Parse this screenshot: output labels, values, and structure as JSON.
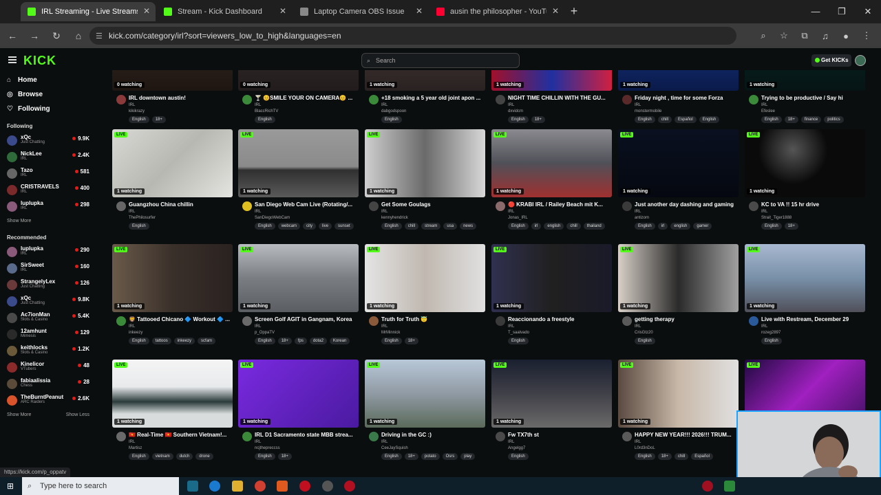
{
  "browser": {
    "tabs": [
      {
        "title": "IRL Streaming - Live Streams on Kick",
        "fav": "#53fc18",
        "active": true
      },
      {
        "title": "Stream - Kick Dashboard",
        "fav": "#53fc18",
        "active": false
      },
      {
        "title": "Laptop Camera OBS Issue",
        "fav": "#888888",
        "active": false
      },
      {
        "title": "ausin the philosopher - YouTube",
        "fav": "#ff0033",
        "active": false
      }
    ],
    "url": "kick.com/category/irl?sort=viewers_low_to_high&languages=en"
  },
  "header": {
    "logo": "KICK",
    "search_placeholder": "Search",
    "get_kicks": "Get KICKs"
  },
  "sidebar": {
    "nav": [
      {
        "label": "Home",
        "icon": "home-icon",
        "glyph": "⌂"
      },
      {
        "label": "Browse",
        "icon": "compass-icon",
        "glyph": "◎"
      },
      {
        "label": "Following",
        "icon": "heart-icon",
        "glyph": "♡"
      }
    ],
    "following_title": "Following",
    "following": [
      {
        "name": "xQc",
        "cat": "Just Chatting",
        "viewers": "9.9K",
        "color": "#3a4a8a"
      },
      {
        "name": "NickLee",
        "cat": "IRL",
        "viewers": "2.4K",
        "color": "#2f6b3a"
      },
      {
        "name": "Tazo",
        "cat": "IRL",
        "viewers": "581",
        "color": "#666666"
      },
      {
        "name": "CRISTRAVELS",
        "cat": "IRL",
        "viewers": "400",
        "color": "#7a2a2a"
      },
      {
        "name": "luplupka",
        "cat": "IRL",
        "viewers": "298",
        "color": "#8a5a7a"
      }
    ],
    "show_more": "Show More",
    "recommended_title": "Recommended",
    "recommended": [
      {
        "name": "luplupka",
        "cat": "IRL",
        "viewers": "290",
        "color": "#8a5a7a"
      },
      {
        "name": "SirSweet",
        "cat": "IRL",
        "viewers": "160",
        "color": "#5a6a8a"
      },
      {
        "name": "StrangelyLex",
        "cat": "Just Chatting",
        "viewers": "126",
        "color": "#6a3a3a"
      },
      {
        "name": "xQc",
        "cat": "Just Chatting",
        "viewers": "9.8K",
        "color": "#3a4a8a"
      },
      {
        "name": "Ac7ionMan",
        "cat": "Slots & Casino",
        "viewers": "5.4K",
        "color": "#4a4a4a"
      },
      {
        "name": "12amhunt",
        "cat": "Mimesis",
        "viewers": "129",
        "color": "#2a2a2a"
      },
      {
        "name": "keithlocks",
        "cat": "Slots & Casino",
        "viewers": "1.2K",
        "color": "#6a5a3a"
      },
      {
        "name": "Kinelicor",
        "cat": "VTubers",
        "viewers": "48",
        "color": "#8a2a2a"
      },
      {
        "name": "fabiaalissia",
        "cat": "Chess",
        "viewers": "28",
        "color": "#5a4a3a"
      },
      {
        "name": "TheBurntPeanut",
        "cat": "ARC Raiders",
        "viewers": "2.6K",
        "color": "#d9542a"
      }
    ],
    "show_more_2": "Show More",
    "show_less": "Show Less"
  },
  "streams": [
    {
      "title": "IRL downtown austin!",
      "cat": "IRL",
      "user": "kikikrazy",
      "watching": "0 watching",
      "tags": [
        "English",
        "18+"
      ],
      "bg": "linear-gradient(#3a2a22,#1e1612)",
      "ava": "#8a3a3a"
    },
    {
      "title": "🍸 😊SMILE YOUR ON CAMERA😊 ...",
      "cat": "IRL",
      "user": "BlaccRichTV",
      "watching": "0 watching",
      "tags": [
        "English"
      ],
      "bg": "linear-gradient(#3a3030,#221c1c)",
      "ava": "#3a8a3a"
    },
    {
      "title": "+18 smoking a 5 year old joint apon ...",
      "cat": "IRL",
      "user": "dabgodspoon",
      "watching": "1 watching",
      "tags": [
        "English"
      ],
      "bg": "linear-gradient(#4a3a3a,#2a2222)",
      "ava": "#3a8a3a"
    },
    {
      "title": "NIGHT TIME CHILLIN WITH THE GU...",
      "cat": "IRL",
      "user": "dxvidcm",
      "watching": "1 watching",
      "tags": [
        "English",
        "18+"
      ],
      "bg": "linear-gradient(90deg,#a0102a,#2030a0,#d02040)",
      "ava": "#444444"
    },
    {
      "title": "Friday night , time for some Forza",
      "cat": "IRL",
      "user": "monstermobile",
      "watching": "1 watching",
      "tags": [
        "English",
        "chill",
        "Español",
        "English"
      ],
      "bg": "linear-gradient(#1a3a8a,#0a1a4a)",
      "ava": "#5a2a2a"
    },
    {
      "title": "Trying to be productive / Say hi",
      "cat": "IRL",
      "user": "Efeslee",
      "watching": "1 watching",
      "tags": [
        "English",
        "18+",
        "finance",
        "politics"
      ],
      "bg": "linear-gradient(#0a2a2a,#061414)",
      "ava": "#3a8a3a"
    },
    {
      "title": "Guangzhou China chillin",
      "cat": "IRL",
      "user": "ThePhilosurfer",
      "watching": "1 watching",
      "tags": [
        "English"
      ],
      "bg": "linear-gradient(135deg,#d8d8d4,#b8b8b2,#e4e4e0)",
      "ava": "#666666"
    },
    {
      "title": "San Diego Web Cam Live (Rotating/...",
      "cat": "IRL",
      "user": "SanDiegoWebCam",
      "watching": "1 watching",
      "tags": [
        "English",
        "webcam",
        "city",
        "live",
        "sunset"
      ],
      "bg": "linear-gradient(#9a9a9a 0%,#8a8a8a 55%,#303030 60%,#5a5a5a 100%)",
      "ava": "#e0c020"
    },
    {
      "title": "Get Some Goulags",
      "cat": "IRL",
      "user": "kennyhendrick",
      "watching": "1 watching",
      "tags": [
        "English",
        "chill",
        "stream",
        "usa",
        "news"
      ],
      "bg": "linear-gradient(90deg,#cfcfcf,#6a6a6a,#d8d8d8)",
      "ava": "#444444"
    },
    {
      "title": "🔴 KRABI IRL / Railey Beach mit K...",
      "cat": "IRL",
      "user": "Jonas_IRL",
      "watching": "1 watching",
      "tags": [
        "English",
        "irl",
        "english",
        "chill",
        "thailand"
      ],
      "bg": "linear-gradient(#8a8a90,#505058,#a03030)",
      "ava": "#8a6a6a"
    },
    {
      "title": "Just another day dashing and gaming",
      "cat": "IRL",
      "user": "antizom",
      "watching": "1 watching",
      "tags": [
        "English",
        "irl",
        "english",
        "gamer"
      ],
      "bg": "linear-gradient(#0a1020,#050810)",
      "ava": "#3a3a3a"
    },
    {
      "title": "KC to VA !! 15 hr drive",
      "cat": "IRL",
      "user": "Strait_Tiger1888",
      "watching": "1 watching",
      "tags": [
        "English",
        "18+"
      ],
      "bg": "radial-gradient(circle at 40% 30%,#555,#0a0a0a 40%)",
      "ava": "#4a4a4a"
    },
    {
      "title": "🦁 Tattooed Chicano 🔷 Workout 🔷 ...",
      "cat": "IRL",
      "user": "inkeezy",
      "watching": "1 watching",
      "tags": [
        "English",
        "tattoos",
        "inkeezy",
        "scfam"
      ],
      "bg": "linear-gradient(90deg,#6a5a4a,#3a302a,#2a2220)",
      "ava": "#3a8a3a"
    },
    {
      "title": "Screen Golf AGIT in Gangnam, Korea",
      "cat": "IRL",
      "user": "p_OppaTV",
      "watching": "1 watching",
      "tags": [
        "English",
        "18+",
        "fps",
        "dota2",
        "Korean"
      ],
      "bg": "linear-gradient(#b8bcc0,#7a7e82,#5a5e62)",
      "ava": "#6a6a6a"
    },
    {
      "title": "Truth for Truth 😇",
      "cat": "IRL",
      "user": "MrMinnick",
      "watching": "1 watching",
      "tags": [
        "English",
        "18+"
      ],
      "bg": "linear-gradient(90deg,#e4e4e4,#c0b8b0,#e0e0e0)",
      "ava": "#8a5a3a"
    },
    {
      "title": "Reaccionando a freestyle",
      "cat": "IRL",
      "user": "T_saalvado",
      "watching": "1 watching",
      "tags": [
        "English"
      ],
      "bg": "linear-gradient(90deg,#303050,#202020,#1a1a2a)",
      "ava": "#3a3a3a"
    },
    {
      "title": "getting therapy",
      "cat": "IRL",
      "user": "CrisGtz20",
      "watching": "1 watching",
      "tags": [
        "English"
      ],
      "bg": "linear-gradient(90deg,#d8d0c8,#2a2a2a,#a0a0a0)",
      "ava": "#5a5a5a"
    },
    {
      "title": "Live with Restream, December 29",
      "cat": "IRL",
      "user": "rozeg2897",
      "watching": "1 watching",
      "tags": [
        "English"
      ],
      "bg": "linear-gradient(#a8b8d0,#7890a8,#50505a)",
      "ava": "#2a5a9a"
    },
    {
      "title": "🇻🇳 Real-Time 🇻🇳 Southern Vietnam!...",
      "cat": "IRL",
      "user": "Martisz",
      "watching": "1 watching",
      "tags": [
        "English",
        "vietnam",
        "dutch",
        "drone"
      ],
      "bg": "linear-gradient(#f4f4f4 0%,#e8eaec 40%,#2a3a3a 62%,#d8dcdc 80%)",
      "ava": "#6a6a6a"
    },
    {
      "title": "IRL D1 Sacramento state MBB strea...",
      "cat": "IRL",
      "user": "ncjthepreccss",
      "watching": "1 watching",
      "tags": [
        "English",
        "18+"
      ],
      "bg": "linear-gradient(135deg,#7a2ae0,#4a1aa0)",
      "ava": "#3a8a3a"
    },
    {
      "title": "Driving in the GC :)",
      "cat": "IRL",
      "user": "CeeJaySquish",
      "watching": "1 watching",
      "tags": [
        "English",
        "18+",
        "potato",
        "Osrs",
        "play"
      ],
      "bg": "linear-gradient(#b8c8d8,#909aa4,#5a6a5a)",
      "ava": "#3a7a4a"
    },
    {
      "title": "Fw TX7th st",
      "cat": "IRL",
      "user": "Angelgg7",
      "watching": "1 watching",
      "tags": [
        "English"
      ],
      "bg": "linear-gradient(#1a2030,#404048,#6a6a6a)",
      "ava": "#4a4a4a"
    },
    {
      "title": "HAPPY NEW YEAR!!! 2026!!! TRUM...",
      "cat": "IRL",
      "user": "L0rd3nDoL",
      "watching": "1 watching",
      "tags": [
        "English",
        "18+",
        "chill",
        "Español"
      ],
      "bg": "linear-gradient(90deg,#5a4a40,#c8b8a8,#e0e0e0)",
      "ava": "#5a5a5a"
    },
    {
      "title": "",
      "cat": "",
      "user": "",
      "watching": "",
      "tags": [],
      "bg": "linear-gradient(135deg,#200a40,#a020c0,#401060)",
      "ava": "#0b0e0f"
    }
  ],
  "status_url": "https://kick.com/p_oppatv",
  "taskbar": {
    "search": "Type here to search"
  }
}
